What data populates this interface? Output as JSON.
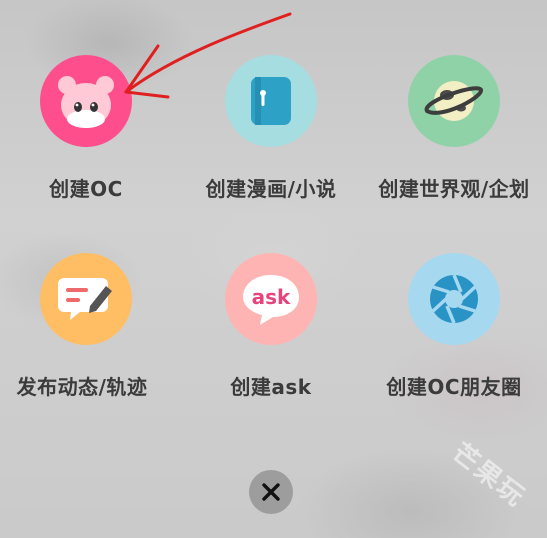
{
  "items": [
    {
      "label": "创建OC",
      "icon": "pig-face-icon",
      "color": "#ff4e8c"
    },
    {
      "label": "创建漫画/小说",
      "icon": "book-icon",
      "color": "#a6dde0"
    },
    {
      "label": "创建世界观/企划",
      "icon": "planet-icon",
      "color": "#90d2a8"
    },
    {
      "label": "发布动态/轨迹",
      "icon": "speech-pencil-icon",
      "color": "#ffbe64"
    },
    {
      "label": "创建ask",
      "icon": "ask-bubble-icon",
      "color": "#ffb4b4"
    },
    {
      "label": "创建OC朋友圈",
      "icon": "camera-aperture-icon",
      "color": "#a6d8f0"
    }
  ],
  "ask_icon_text": "ask",
  "close": {
    "icon": "close-icon"
  },
  "watermark": "芒果玩",
  "annotation": {
    "icon": "red-arrow-annotation",
    "color": "#e02020"
  }
}
